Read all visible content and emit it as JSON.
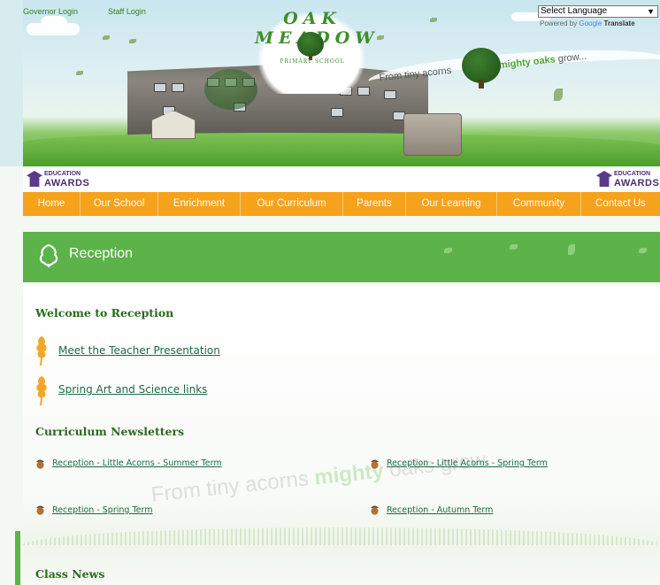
{
  "top_links": {
    "governor": "Governor Login",
    "staff": "Staff Login"
  },
  "school": {
    "name": "OAK MEADOW",
    "subtitle": "PRIMARY SCHOOL"
  },
  "tagline": {
    "lead": "From tiny acorns",
    "accent": "mighty oaks",
    "tail": "grow..."
  },
  "translate": {
    "selected": "Select Language",
    "powered_by": "Powered by",
    "google": "Google",
    "translate": "Translate"
  },
  "awards": {
    "line1": "EDUCATION",
    "line2": "AWARDS"
  },
  "nav": [
    "Home",
    "Our School",
    "Enrichment",
    "Our Curriculum",
    "Parents",
    "Our Learning",
    "Community",
    "Contact Us"
  ],
  "page": {
    "title": "Reception"
  },
  "welcome": {
    "heading": "Welcome to Reception",
    "links": [
      "Meet the Teacher Presentation",
      "Spring Art and Science links"
    ]
  },
  "newsletters": {
    "heading": "Curriculum Newsletters",
    "items": [
      "Reception - Little Acorns - Summer Term",
      "Reception - Little Acorns - Spring Term",
      "Reception - Spring Term",
      "Reception - Autumn Term"
    ]
  },
  "watermark": {
    "lead": "From tiny acorns",
    "accent": "mighty",
    "tail": "oaks grow"
  },
  "class_news": {
    "heading": "Class News"
  },
  "colors": {
    "nav": "#f7a21b",
    "header": "#5cb34a",
    "heading": "#2a6a1e",
    "link": "#1e6a43"
  }
}
